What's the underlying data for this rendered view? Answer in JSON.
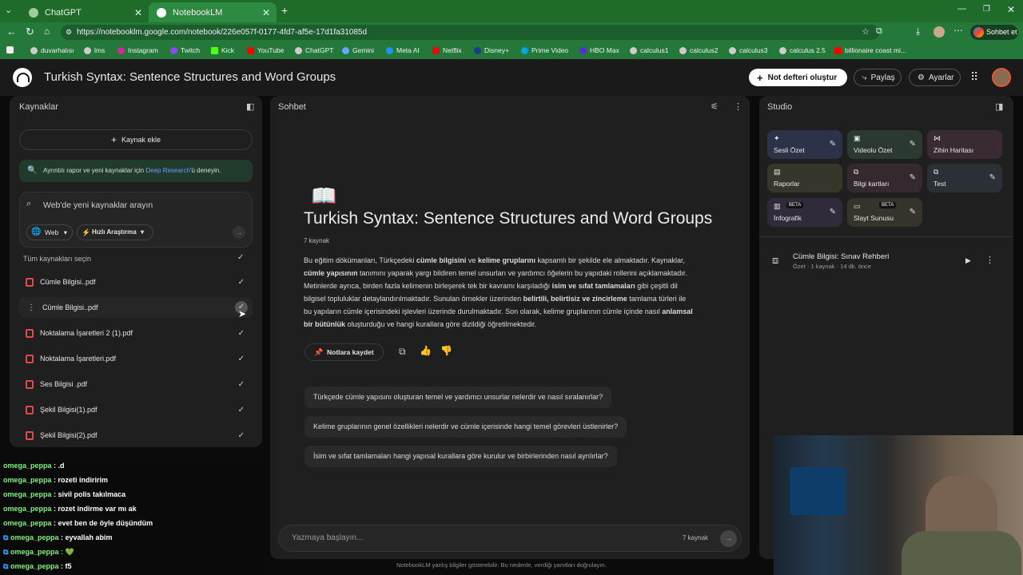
{
  "tabs": [
    {
      "label": "ChatGPT"
    },
    {
      "label": "NotebookLM"
    }
  ],
  "url": "https://notebooklm.google.com/notebook/226e057f-0177-4fd7-af5e-17d1fa31085d",
  "profile_button": "Sohbet et",
  "bookmarks": [
    "duvarhalısı",
    "lms",
    "Instagram",
    "Twitch",
    "Kick",
    "YouTube",
    "ChatGPT",
    "Gemini",
    "Meta AI",
    "Netflix",
    "Disney+",
    "Prime Video",
    "HBO Max",
    "calculus1",
    "calculus2",
    "calculus3",
    "calculus 2.5",
    "billionaire coast mi..."
  ],
  "header": {
    "title": "Turkish Syntax: Sentence Structures and Word Groups",
    "create_btn": "Not defteri oluştur",
    "share_btn": "Paylaş",
    "settings_btn": "Ayarlar"
  },
  "sources": {
    "title": "Kaynaklar",
    "add_btn": "Kaynak ekle",
    "banner_pre": "Ayrıntılı rapor ve yeni kaynaklar için ",
    "banner_link": "Deep Research",
    "banner_post": "'ü deneyin.",
    "search_placeholder": "Web'de yeni kaynaklar arayın",
    "filter_web": "Web",
    "filter_fast": "Hızlı Araştırma",
    "select_all": "Tüm kaynakları seçin",
    "items": [
      "Cümle Bilgisi..pdf",
      "Cümle Bilgisi..pdf",
      "Noktalama İşaretleri 2 (1).pdf",
      "Noktalama İşaretleri.pdf",
      "Ses Bilgisi .pdf",
      "Şekil Bilgisi(1).pdf",
      "Şekil Bilgisi(2).pdf"
    ]
  },
  "chat": {
    "title": "Sohbet",
    "emoji": "📖",
    "heading": "Turkish Syntax: Sentence Structures and Word Groups",
    "source_count": "7 kaynak",
    "summary_parts": [
      "Bu eğitim dökümanları, Türkçedeki ",
      "cümle bilgisini",
      " ve ",
      "kelime gruplarını",
      " kapsamlı bir şekilde ele almaktadır. Kaynaklar, ",
      "cümle yapısının",
      " tanımını yaparak yargı bildiren temel unsurları ve yardımcı öğelerin bu yapıdaki rollerini açıklamaktadır. Metinlerde ayrıca, birden fazla kelimenin birleşerek tek bir kavramı karşıladığı ",
      "isim ve sıfat tamlamaları",
      " gibi çeşitli dil bilgisel topluluklar detaylandırılmaktadır. Sunulan örnekler üzerinden ",
      "belirtili, belirtisiz ve zincirleme",
      " tamlama türleri ile bu yapıların cümle içerisindeki işlevleri üzerinde durulmaktadır. Son olarak, kelime gruplarının cümle içinde nasıl ",
      "anlamsal bir bütünlük",
      " oluşturduğu ve hangi kurallara göre dizildiği öğretilmektedir."
    ],
    "save_note": "Notlara kaydet",
    "questions": [
      "Türkçede cümle yapısını oluşturan temel ve yardımcı unsurlar nelerdir ve nasıl sıralanırlar?",
      "Kelime gruplarının genel özellikleri nelerdir ve cümle içerisinde hangi temel görevleri üstlenirler?",
      "İsim ve sıfat tamlamaları hangi yapısal kurallara göre kurulur ve birbirlerinden nasıl ayrılırlar?"
    ],
    "input_placeholder": "Yazmaya başlayın...",
    "input_count": "7 kaynak",
    "disclaimer": "NotebookLM yanlış bilgiler gösterebilir. Bu nedenle, verdiği yanıtları doğrulayın."
  },
  "studio": {
    "title": "Studio",
    "tiles": [
      {
        "label": "Sesli Özet",
        "beta": ""
      },
      {
        "label": "Videolu Özet",
        "beta": ""
      },
      {
        "label": "Zihin Haritası",
        "beta": ""
      },
      {
        "label": "Raporlar",
        "beta": ""
      },
      {
        "label": "Bilgi kartları",
        "beta": ""
      },
      {
        "label": "Test",
        "beta": ""
      },
      {
        "label": "İnfografik",
        "beta": "BETA"
      },
      {
        "label": "Slayt Sunusu",
        "beta": "BETA"
      }
    ],
    "note_title": "Cümle Bilgisi: Sınav Rehberi",
    "note_meta": "Özet · 1 kaynak · 14 dk. önce"
  },
  "stream_chat": [
    {
      "user": "omega_peppa",
      "msg": ": .d"
    },
    {
      "user": "omega_peppa",
      "msg": ": rozeti indiririm"
    },
    {
      "user": "omega_peppa",
      "msg": ": sivil polis takılmaca"
    },
    {
      "user": "omega_peppa",
      "msg": ": rozet indirme var mı ak"
    },
    {
      "user": "omega_peppa",
      "msg": ": evet ben de öyle düşündüm"
    },
    {
      "user": "omega_peppa",
      "msg": ": eyvallah abim"
    },
    {
      "user": "omega_peppa",
      "msg": ": 💚"
    },
    {
      "user": "omega_peppa",
      "msg": ": f5"
    }
  ]
}
